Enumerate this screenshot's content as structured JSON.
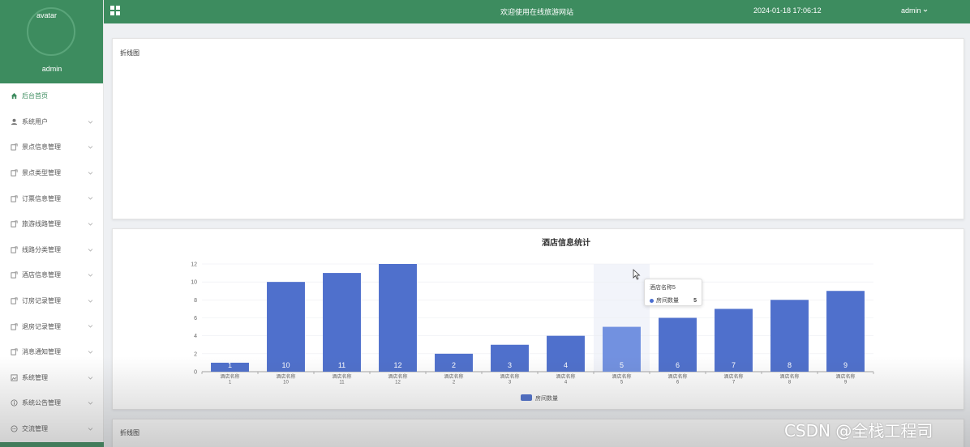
{
  "sidebar": {
    "avatar_alt": "avatar",
    "username": "admin",
    "items": [
      {
        "label": "后台首页",
        "icon": "home-icon"
      },
      {
        "label": "系统用户",
        "icon": "user-icon"
      },
      {
        "label": "景点信息管理",
        "icon": "edit-icon"
      },
      {
        "label": "景点类型管理",
        "icon": "edit-icon"
      },
      {
        "label": "订票信息管理",
        "icon": "edit-icon"
      },
      {
        "label": "旅游线路管理",
        "icon": "edit-icon"
      },
      {
        "label": "线路分类管理",
        "icon": "edit-icon"
      },
      {
        "label": "酒店信息管理",
        "icon": "edit-icon"
      },
      {
        "label": "订房记录管理",
        "icon": "edit-icon"
      },
      {
        "label": "退房记录管理",
        "icon": "edit-icon"
      },
      {
        "label": "消息通知管理",
        "icon": "edit-icon"
      },
      {
        "label": "系统管理",
        "icon": "picture-icon"
      },
      {
        "label": "系统公告管理",
        "icon": "info-icon"
      },
      {
        "label": "交流管理",
        "icon": "chat-icon"
      }
    ]
  },
  "header": {
    "site_title": "欢迎使用在线旅游网站",
    "datetime": "2024-01-18 17:06:12",
    "user": "admin"
  },
  "cards": {
    "card1_title": "折线图",
    "card3_title": "折线图"
  },
  "tooltip": {
    "title": "酒店名称5",
    "series": "房间数量",
    "value": "5"
  },
  "watermark": "CSDN @全栈工程司",
  "colors": {
    "brand": "#3d8c5f",
    "bar": "#4f70cc",
    "bar_highlight": "#7291e0"
  },
  "chart_data": {
    "type": "bar",
    "title": "酒店信息统计",
    "categories": [
      "酒店名称\n1",
      "酒店名称\n10",
      "酒店名称\n11",
      "酒店名称\n12",
      "酒店名称\n2",
      "酒店名称\n3",
      "酒店名称\n4",
      "酒店名称\n5",
      "酒店名称\n6",
      "酒店名称\n7",
      "酒店名称\n8",
      "酒店名称\n9"
    ],
    "series": [
      {
        "name": "房间数量",
        "values": [
          1,
          10,
          11,
          12,
          2,
          3,
          4,
          5,
          6,
          7,
          8,
          9
        ]
      }
    ],
    "ylim": [
      0,
      12
    ],
    "yticks": [
      0,
      2,
      4,
      6,
      8,
      10,
      12
    ],
    "highlight_index": 7,
    "grid": true,
    "legend": "bottom-center"
  }
}
